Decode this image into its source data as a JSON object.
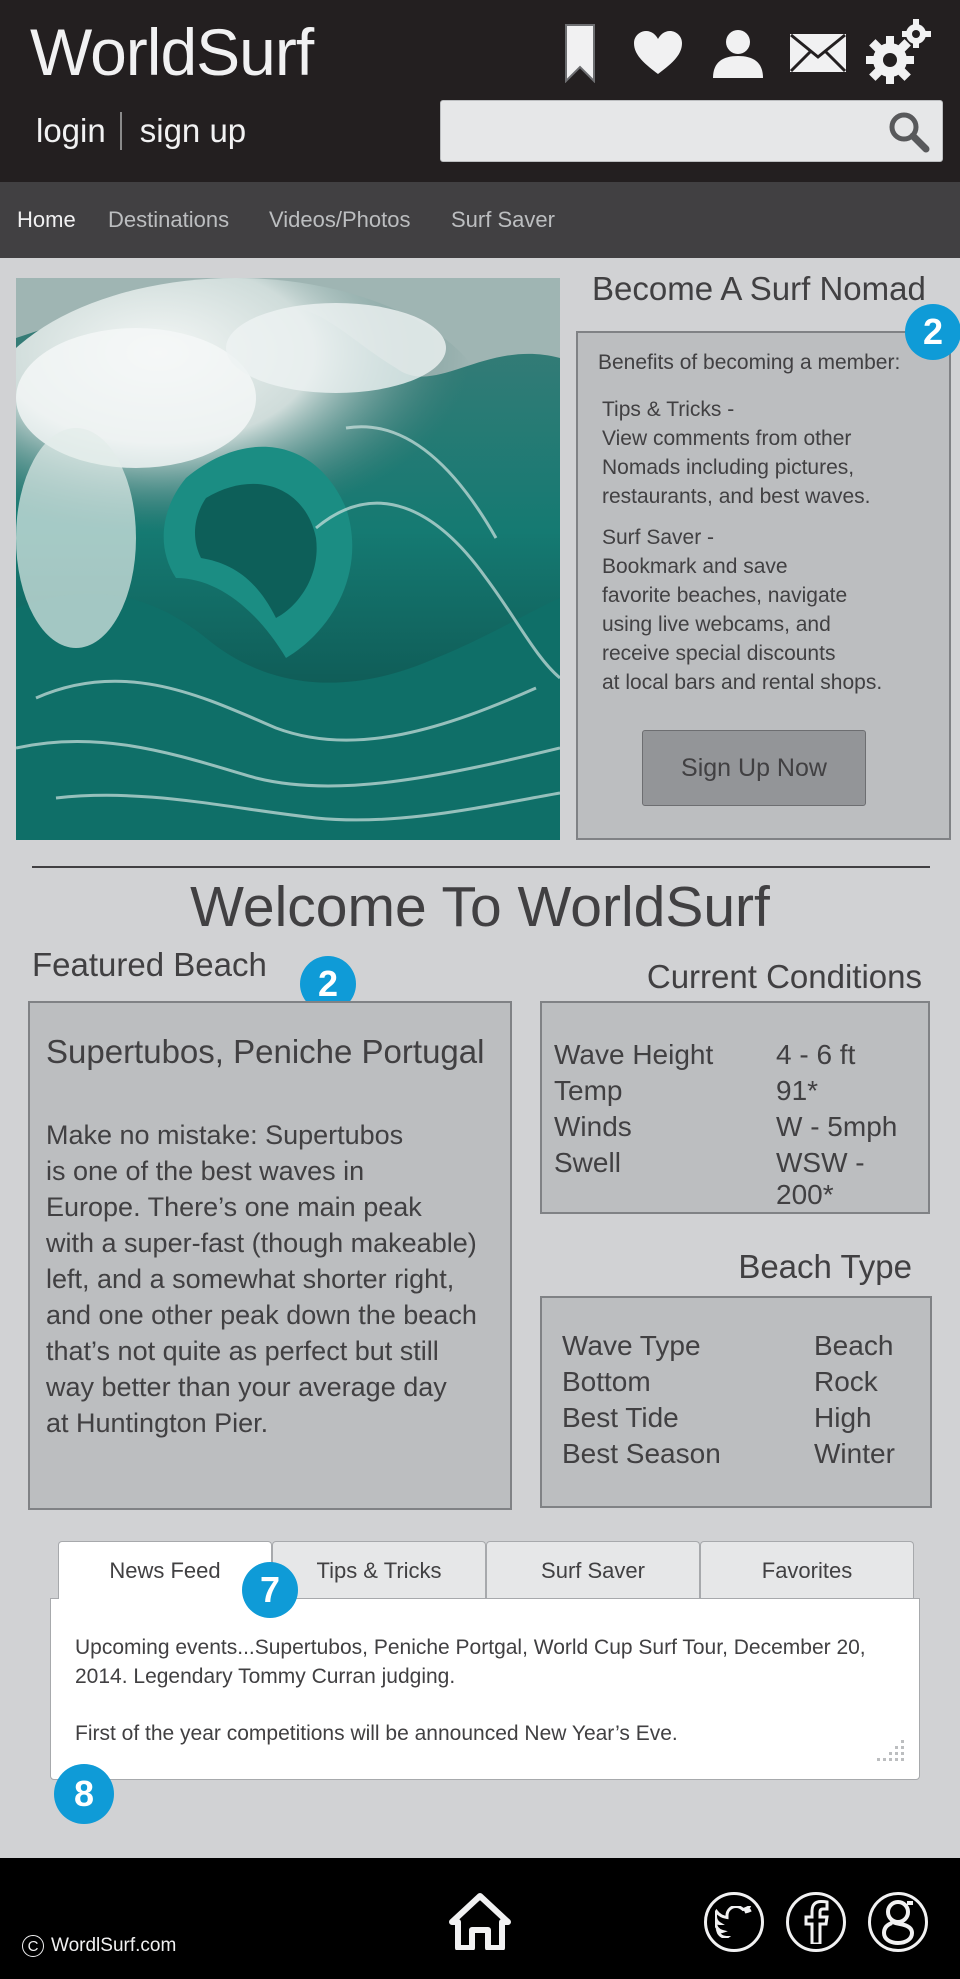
{
  "header": {
    "logo": "WorldSurf",
    "login_label": "login",
    "signup_label": "sign up",
    "search_placeholder": ""
  },
  "nav": {
    "items": [
      "Home",
      "Destinations",
      "Videos/Photos",
      "Surf Saver"
    ],
    "active": "Home"
  },
  "nomad": {
    "title": "Become A Surf Nomad",
    "badge": "2",
    "intro": "Benefits of becoming a member:",
    "tips": "Tips & Tricks -\nView comments from other\nNomads including pictures,\nrestaurants, and best waves.",
    "saver": "Surf Saver -\nBookmark and save\nfavorite beaches, navigate\nusing live webcams, and\nreceive special discounts\nat local bars and rental shops.",
    "button": "Sign Up Now"
  },
  "welcome": "Welcome To WorldSurf",
  "featured": {
    "title": "Featured Beach",
    "badge": "2",
    "name": "Supertubos, Peniche Portugal",
    "description": "Make no mistake: Supertubos\nis one of the best waves in\nEurope.  There’s one main peak\nwith a super-fast (though makeable)\nleft, and a somewhat shorter right,\nand one other peak down the beach\nthat’s not quite as perfect but still\nway better than your average day\nat Huntington Pier."
  },
  "conditions": {
    "title": "Current Conditions",
    "rows": [
      {
        "label": "Wave Height",
        "value": "4 - 6 ft"
      },
      {
        "label": "Temp",
        "value": "91*"
      },
      {
        "label": "Winds",
        "value": "W - 5mph"
      },
      {
        "label": "Swell",
        "value": "WSW - 200*"
      }
    ]
  },
  "beach_type": {
    "title": "Beach Type",
    "rows": [
      {
        "label": "Wave Type",
        "value": "Beach"
      },
      {
        "label": "Bottom",
        "value": "Rock"
      },
      {
        "label": "Best Tide",
        "value": "High"
      },
      {
        "label": "Best Season",
        "value": "Winter"
      }
    ]
  },
  "tabs": {
    "items": [
      "News Feed",
      "Tips & Tricks",
      "Surf Saver",
      "Favorites"
    ],
    "active": "News Feed",
    "badge": "7",
    "panel_line1": "Upcoming events...Supertubos, Peniche Portgal, World Cup Surf Tour, December 20, 2014.  Legendary Tommy Curran judging.",
    "panel_line2": "First of the year competitions will be announced New Year’s Eve.",
    "panel_badge": "8"
  },
  "footer": {
    "copyright_symbol": "C",
    "copyright": "WordlSurf.com"
  },
  "colors": {
    "header_bg": "#231f20",
    "nav_bg": "#414042",
    "page_bg": "#d1d2d4",
    "panel_bg": "#bcbec0",
    "badge": "#0f9bd7",
    "footer_bg": "#000000"
  },
  "icons": [
    "bookmark-icon",
    "heart-icon",
    "user-icon",
    "mail-icon",
    "gear-icon",
    "search-icon",
    "home-icon",
    "twitter-icon",
    "facebook-icon",
    "google-icon"
  ]
}
